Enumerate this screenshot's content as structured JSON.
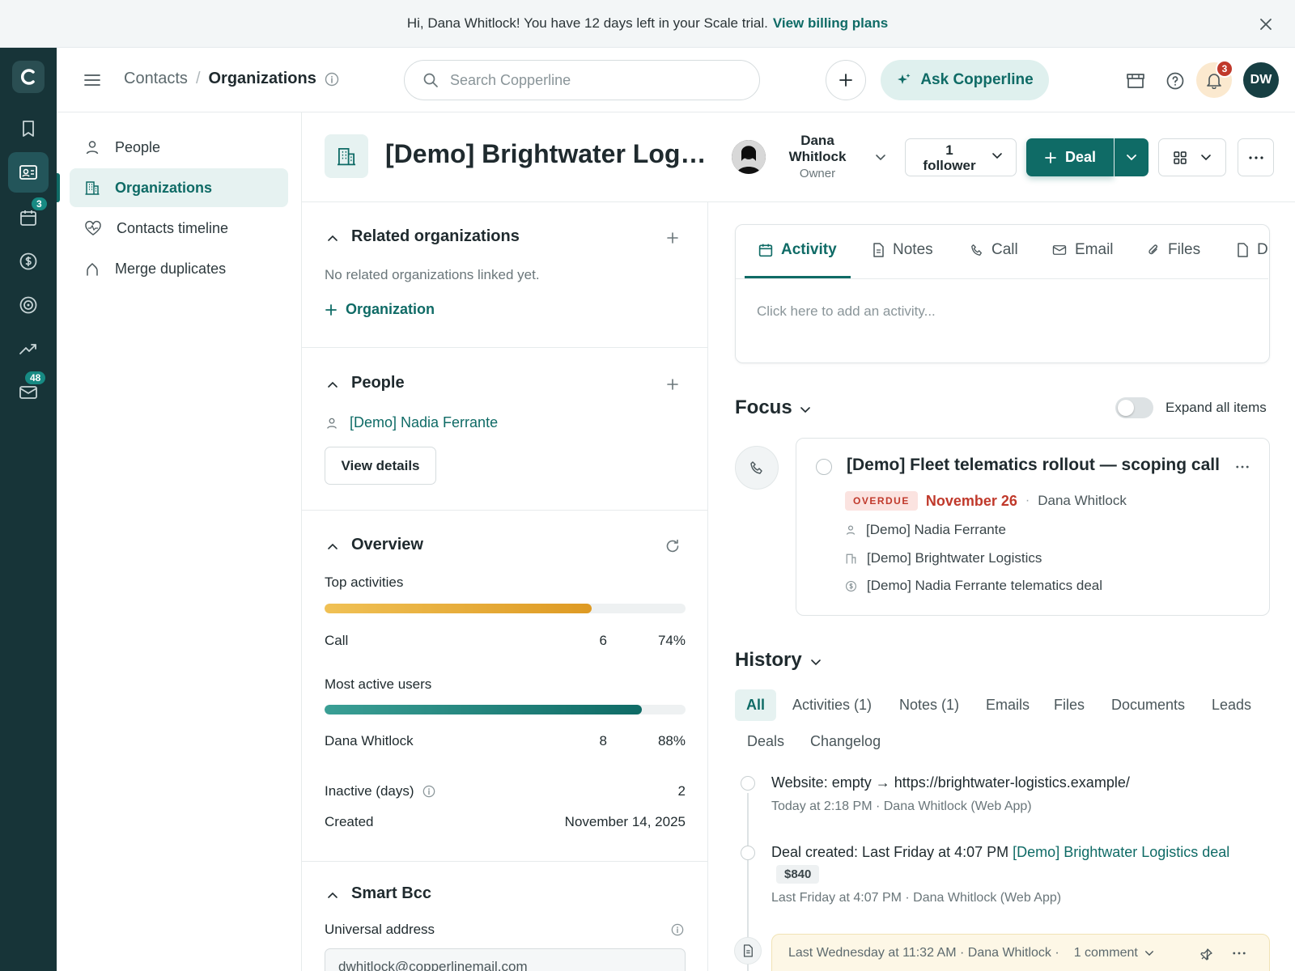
{
  "banner": {
    "text": "Hi, Dana Whitlock! You have 12 days left in your Scale trial.",
    "link": "View billing plans"
  },
  "rail": {
    "logo": "C",
    "items": [
      {
        "icon": "bookmark-icon"
      },
      {
        "icon": "contacts-card-icon",
        "active": true
      },
      {
        "icon": "calendar-icon",
        "badge": "3"
      },
      {
        "icon": "dollar-icon"
      },
      {
        "icon": "target-icon"
      },
      {
        "icon": "trend-icon"
      },
      {
        "icon": "mail-icon",
        "badge": "48"
      }
    ]
  },
  "header": {
    "crumb_parent": "Contacts",
    "crumb_sep": "/",
    "crumb_current": "Organizations",
    "search_placeholder": "Search Copperline",
    "ask_label": "Ask Copperline",
    "notif_count": "3",
    "user_initials": "DW"
  },
  "leftnav": {
    "items": [
      {
        "label": "People",
        "icon": "person-icon"
      },
      {
        "label": "Organizations",
        "icon": "building-icon",
        "active": true
      },
      {
        "label": "Contacts timeline",
        "icon": "heartbeat-icon"
      },
      {
        "label": "Merge duplicates",
        "icon": "merge-icon"
      }
    ]
  },
  "record": {
    "title": "[Demo] Brightwater Logistics",
    "owner_first": "Dana",
    "owner_last": "Whitlock",
    "owner_role": "Owner",
    "followers_count": "1",
    "followers_label": "follower",
    "deal_label": "Deal"
  },
  "related": {
    "title": "Related organizations",
    "empty": "No related organizations linked yet.",
    "add_label": "Organization"
  },
  "people": {
    "title": "People",
    "person": "[Demo] Nadia Ferrante",
    "view_details": "View details"
  },
  "overview": {
    "title": "Overview",
    "top_activities_label": "Top activities",
    "top_activity": {
      "name": "Call",
      "count": "6",
      "percent": "74%",
      "fill": 0.74
    },
    "most_active_label": "Most active users",
    "most_active": {
      "name": "Dana Whitlock",
      "count": "8",
      "percent": "88%",
      "fill": 0.88
    },
    "inactive_label": "Inactive (days)",
    "inactive_value": "2",
    "created_label": "Created",
    "created_value": "November 14, 2025"
  },
  "smart_bcc": {
    "title": "Smart Bcc",
    "universal_label": "Universal address",
    "address": "dwhitlock@copperlinemail.com"
  },
  "composer": {
    "tabs": [
      "Activity",
      "Notes",
      "Call",
      "Email",
      "Files",
      "D"
    ],
    "placeholder": "Click here to add an activity..."
  },
  "focus": {
    "title": "Focus",
    "expand_label": "Expand all items",
    "card": {
      "title": "[Demo] Fleet telematics rollout — scoping call",
      "status": "OVERDUE",
      "date": "November 26",
      "sep": "·",
      "owner": "Dana Whitlock",
      "person": "[Demo] Nadia Ferrante",
      "org": "[Demo] Brightwater Logistics",
      "deal": "[Demo] Nadia Ferrante telematics deal"
    }
  },
  "history": {
    "title": "History",
    "tabs": [
      "All",
      "Activities (1)",
      "Notes (1)",
      "Emails",
      "Files",
      "Documents",
      "Leads",
      "Deals",
      "Changelog"
    ],
    "items": [
      {
        "text": "Website: empty → https://brightwater-logistics.example/",
        "meta": "Today at 2:18 PM · Dana Whitlock (Web App)"
      },
      {
        "text": "Deal created: Last Friday at 4:07 PM",
        "link": "[Demo] Brightwater Logistics deal",
        "amount": "$840",
        "meta": "Last Friday at 4:07 PM · Dana Whitlock (Web App)"
      }
    ],
    "note_meta": "Last Wednesday at 11:32 AM · Dana Whitlock ·",
    "note_comments": "1 comment"
  },
  "colors": {
    "accent": "#0f6b66",
    "rail": "#173438",
    "overdue": "#c0392b",
    "activity_bar": "#e4a62f",
    "users_bar": "#137a72"
  }
}
